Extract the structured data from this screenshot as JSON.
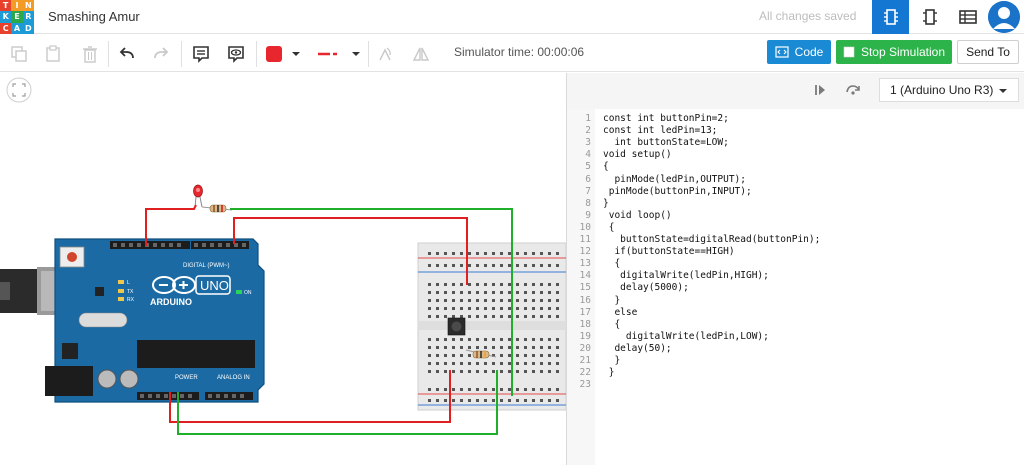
{
  "app": {
    "logo_letters": [
      "T",
      "I",
      "N",
      "K",
      "E",
      "R",
      "C",
      "A",
      "D"
    ],
    "logo_colors": [
      "#e8412b",
      "#f29b25",
      "#f29b25",
      "#1d9bd6",
      "#2aa84a",
      "#1d9bd6",
      "#e8412b",
      "#1d9bd6",
      "#1d9bd6"
    ],
    "project_title": "Smashing Amur",
    "save_status": "All changes saved"
  },
  "toolbar": {
    "simulator_time": "Simulator time: 00:00:06",
    "code_label": "Code",
    "stop_label": "Stop Simulation",
    "send_label": "Send To",
    "fill_color": "#e8262d",
    "line_color": "#e8262d"
  },
  "code_panel": {
    "device": "1 (Arduino Uno R3)",
    "line_numbers": [
      "1",
      "2",
      "3",
      "4",
      "5",
      "6",
      "7",
      "8",
      "9",
      "10",
      "11",
      "12",
      "13",
      "14",
      "15",
      "16",
      "17",
      "18",
      "19",
      "20",
      "21",
      "22",
      "23"
    ],
    "lines": [
      "const int buttonPin=2;",
      "const int ledPin=13;",
      "  int buttonState=LOW;",
      "void setup()",
      "{",
      "  pinMode(ledPin,OUTPUT);",
      " pinMode(buttonPin,INPUT);",
      "}",
      " void loop()",
      " {",
      "   buttonState=digitalRead(buttonPin);",
      "  if(buttonState==HIGH)",
      "  {",
      "   digitalWrite(ledPin,HIGH);",
      "   delay(5000);",
      "  }",
      "  else",
      "  {",
      "    digitalWrite(ledPin,LOW);",
      "  delay(50);",
      "  }",
      " }",
      ""
    ]
  },
  "board": {
    "arduino_label": "ARDUINO",
    "model_label": "UNO",
    "digital_label": "DIGITAL (PWM~)",
    "power_label": "POWER",
    "analog_label": "ANALOG IN",
    "tx_label": "TX",
    "rx_label": "RX",
    "l_label": "L",
    "on_label": "ON"
  }
}
